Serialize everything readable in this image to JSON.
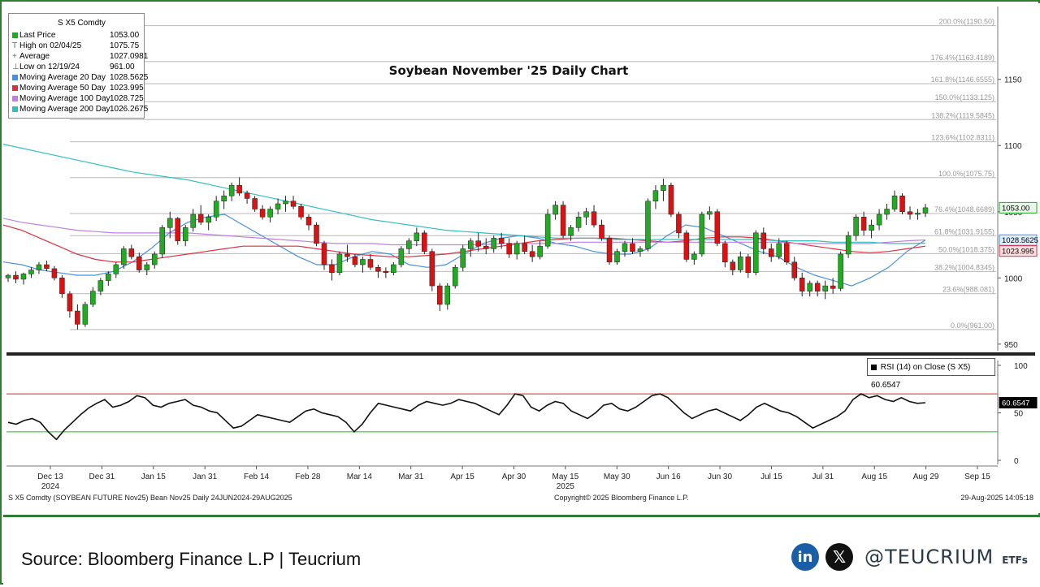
{
  "legend": {
    "title": "S X5 Comdty",
    "rows": [
      {
        "label": "Last Price",
        "value": "1053.00",
        "color": "#22aa22",
        "marker": "⊟"
      },
      {
        "label": "High on 02/04/25",
        "value": "1075.75",
        "color": "",
        "marker": "T"
      },
      {
        "label": "Average",
        "value": "1027.0981",
        "color": "",
        "marker": "+"
      },
      {
        "label": "Low on 12/19/24",
        "value": "961.00",
        "color": "",
        "marker": "⊥"
      },
      {
        "label": "Moving Average 20 Day",
        "value": "1028.5625",
        "color": "#4a90e2",
        "marker": "⊟"
      },
      {
        "label": "Moving Average 50 Day",
        "value": "1023.995",
        "color": "#e03040",
        "marker": "⊟"
      },
      {
        "label": "Moving Average 100 Day",
        "value": "1028.725",
        "color": "#c080e0",
        "marker": "⊟"
      },
      {
        "label": "Moving Average 200 Day",
        "value": "1026.2675",
        "color": "#30c0c0",
        "marker": "⊟"
      }
    ]
  },
  "chart_data": {
    "type": "candlestick",
    "title": "Soybean November '25 Daily Chart",
    "price_axis": {
      "ticks": [
        950,
        1000,
        1050,
        1100,
        1150
      ],
      "range": [
        945,
        1205
      ]
    },
    "rsi_axis": {
      "ticks": [
        0,
        50,
        100
      ],
      "range": [
        0,
        100
      ],
      "overbought": 70,
      "oversold": 30
    },
    "x_labels": [
      "Dec 13",
      "Dec 31",
      "Jan 15",
      "Jan 31",
      "Feb 14",
      "Feb 28",
      "Mar 14",
      "Mar 31",
      "Apr 15",
      "Apr 30",
      "May 15",
      "May 30",
      "Jun 16",
      "Jun 30",
      "Jul 15",
      "Jul 31",
      "Aug 15",
      "Aug 29",
      "Sep 15"
    ],
    "year_labels": [
      {
        "label": "2024",
        "at": "Dec 13"
      },
      {
        "label": "2025",
        "at": "May 15"
      }
    ],
    "fibonacci": [
      {
        "label": "200.0%(1190.50)",
        "value": 1190.5
      },
      {
        "label": "176.4%(1163.4189)",
        "value": 1163.4189
      },
      {
        "label": "161.8%(1146.6555)",
        "value": 1146.6555
      },
      {
        "label": "150.0%(1133.125)",
        "value": 1133.125
      },
      {
        "label": "138.2%(1119.5845)",
        "value": 1119.5845
      },
      {
        "label": "123.6%(1102.8311)",
        "value": 1102.8311
      },
      {
        "label": "100.0%(1075.75)",
        "value": 1075.75
      },
      {
        "label": "76.4%(1048.6689)",
        "value": 1048.6689
      },
      {
        "label": "61.8%(1031.9155)",
        "value": 1031.9155
      },
      {
        "label": "50.0%(1018.375)",
        "value": 1018.375
      },
      {
        "label": "38.2%(1004.8345)",
        "value": 1004.8345
      },
      {
        "label": "23.6%(988.081)",
        "value": 988.081
      },
      {
        "label": "0.0%(961.00)",
        "value": 961.0
      }
    ],
    "candles": [
      [
        1000,
        1003,
        997,
        1002
      ],
      [
        1002,
        1005,
        996,
        999
      ],
      [
        999,
        1004,
        995,
        1003
      ],
      [
        1003,
        1008,
        1000,
        1006
      ],
      [
        1006,
        1012,
        1003,
        1010
      ],
      [
        1010,
        1013,
        1005,
        1007
      ],
      [
        1007,
        1009,
        998,
        1000
      ],
      [
        1000,
        1002,
        985,
        988
      ],
      [
        988,
        990,
        970,
        975
      ],
      [
        975,
        980,
        961,
        965
      ],
      [
        965,
        982,
        963,
        980
      ],
      [
        980,
        993,
        978,
        990
      ],
      [
        990,
        1000,
        987,
        998
      ],
      [
        998,
        1005,
        994,
        1003
      ],
      [
        1003,
        1012,
        1000,
        1010
      ],
      [
        1010,
        1024,
        1007,
        1022
      ],
      [
        1022,
        1025,
        1014,
        1016
      ],
      [
        1016,
        1019,
        1004,
        1006
      ],
      [
        1006,
        1012,
        1002,
        1010
      ],
      [
        1010,
        1020,
        1007,
        1018
      ],
      [
        1018,
        1040,
        1015,
        1038
      ],
      [
        1038,
        1050,
        1030,
        1045
      ],
      [
        1045,
        1046,
        1025,
        1028
      ],
      [
        1028,
        1040,
        1024,
        1038
      ],
      [
        1038,
        1052,
        1035,
        1048
      ],
      [
        1048,
        1055,
        1040,
        1042
      ],
      [
        1042,
        1048,
        1036,
        1046
      ],
      [
        1046,
        1062,
        1043,
        1058
      ],
      [
        1058,
        1066,
        1052,
        1062
      ],
      [
        1062,
        1072,
        1058,
        1070
      ],
      [
        1070,
        1076,
        1062,
        1064
      ],
      [
        1064,
        1066,
        1056,
        1060
      ],
      [
        1060,
        1062,
        1050,
        1052
      ],
      [
        1052,
        1055,
        1044,
        1046
      ],
      [
        1046,
        1054,
        1042,
        1052
      ],
      [
        1052,
        1060,
        1048,
        1056
      ],
      [
        1056,
        1062,
        1050,
        1058
      ],
      [
        1058,
        1062,
        1052,
        1054
      ],
      [
        1054,
        1056,
        1044,
        1046
      ],
      [
        1046,
        1048,
        1036,
        1040
      ],
      [
        1040,
        1042,
        1024,
        1026
      ],
      [
        1026,
        1028,
        1006,
        1010
      ],
      [
        1010,
        1014,
        998,
        1004
      ],
      [
        1004,
        1020,
        1002,
        1018
      ],
      [
        1018,
        1025,
        1012,
        1016
      ],
      [
        1016,
        1018,
        1008,
        1010
      ],
      [
        1010,
        1016,
        1004,
        1014
      ],
      [
        1014,
        1018,
        1006,
        1008
      ],
      [
        1008,
        1010,
        1000,
        1005
      ],
      [
        1005,
        1008,
        1000,
        1004
      ],
      [
        1004,
        1012,
        1002,
        1010
      ],
      [
        1010,
        1024,
        1008,
        1022
      ],
      [
        1022,
        1030,
        1018,
        1028
      ],
      [
        1028,
        1038,
        1024,
        1034
      ],
      [
        1034,
        1036,
        1018,
        1020
      ],
      [
        1020,
        1022,
        990,
        994
      ],
      [
        994,
        996,
        975,
        980
      ],
      [
        980,
        996,
        976,
        994
      ],
      [
        994,
        1010,
        992,
        1008
      ],
      [
        1008,
        1025,
        1005,
        1022
      ],
      [
        1022,
        1030,
        1016,
        1028
      ],
      [
        1028,
        1034,
        1020,
        1024
      ],
      [
        1024,
        1030,
        1018,
        1022
      ],
      [
        1022,
        1032,
        1019,
        1030
      ],
      [
        1030,
        1034,
        1022,
        1026
      ],
      [
        1026,
        1030,
        1015,
        1018
      ],
      [
        1018,
        1028,
        1014,
        1026
      ],
      [
        1026,
        1032,
        1018,
        1020
      ],
      [
        1020,
        1025,
        1012,
        1016
      ],
      [
        1016,
        1028,
        1014,
        1024
      ],
      [
        1024,
        1052,
        1022,
        1048
      ],
      [
        1048,
        1058,
        1044,
        1055
      ],
      [
        1055,
        1058,
        1030,
        1032
      ],
      [
        1032,
        1040,
        1028,
        1038
      ],
      [
        1038,
        1050,
        1035,
        1046
      ],
      [
        1046,
        1053,
        1040,
        1050
      ],
      [
        1050,
        1055,
        1038,
        1040
      ],
      [
        1040,
        1044,
        1028,
        1030
      ],
      [
        1030,
        1032,
        1010,
        1012
      ],
      [
        1012,
        1022,
        1010,
        1020
      ],
      [
        1020,
        1028,
        1016,
        1026
      ],
      [
        1026,
        1030,
        1018,
        1020
      ],
      [
        1020,
        1024,
        1016,
        1022
      ],
      [
        1022,
        1060,
        1020,
        1058
      ],
      [
        1058,
        1070,
        1052,
        1066
      ],
      [
        1066,
        1075,
        1058,
        1070
      ],
      [
        1070,
        1072,
        1046,
        1048
      ],
      [
        1048,
        1050,
        1030,
        1034
      ],
      [
        1034,
        1036,
        1012,
        1014
      ],
      [
        1014,
        1020,
        1010,
        1018
      ],
      [
        1018,
        1050,
        1016,
        1048
      ],
      [
        1048,
        1054,
        1044,
        1050
      ],
      [
        1050,
        1052,
        1024,
        1026
      ],
      [
        1026,
        1028,
        1008,
        1012
      ],
      [
        1012,
        1014,
        1002,
        1006
      ],
      [
        1006,
        1020,
        1004,
        1016
      ],
      [
        1016,
        1018,
        1000,
        1004
      ],
      [
        1004,
        1036,
        1002,
        1034
      ],
      [
        1034,
        1038,
        1018,
        1022
      ],
      [
        1022,
        1026,
        1012,
        1016
      ],
      [
        1016,
        1030,
        1014,
        1026
      ],
      [
        1026,
        1028,
        1010,
        1012
      ],
      [
        1012,
        1016,
        998,
        1000
      ],
      [
        1000,
        1004,
        986,
        990
      ],
      [
        990,
        998,
        986,
        996
      ],
      [
        996,
        998,
        986,
        990
      ],
      [
        990,
        998,
        984,
        994
      ],
      [
        994,
        1000,
        988,
        992
      ],
      [
        992,
        1020,
        990,
        1018
      ],
      [
        1018,
        1035,
        1015,
        1032
      ],
      [
        1032,
        1048,
        1028,
        1046
      ],
      [
        1046,
        1050,
        1032,
        1036
      ],
      [
        1036,
        1044,
        1030,
        1040
      ],
      [
        1040,
        1052,
        1036,
        1048
      ],
      [
        1048,
        1056,
        1044,
        1052
      ],
      [
        1052,
        1066,
        1050,
        1062
      ],
      [
        1062,
        1064,
        1048,
        1050
      ],
      [
        1050,
        1054,
        1044,
        1048
      ],
      [
        1048,
        1052,
        1044,
        1049
      ],
      [
        1049,
        1056,
        1046,
        1053
      ]
    ],
    "moving_averages": [
      {
        "name": "Moving Average 20 Day",
        "color": "#4a90e2",
        "values": [
          1012,
          1010,
          1006,
          1004,
          1002,
          1002,
          1005,
          1012,
          1022,
          1034,
          1042,
          1046,
          1048,
          1040,
          1032,
          1024,
          1016,
          1010,
          1010,
          1016,
          1020,
          1018,
          1010,
          1008,
          1010,
          1018,
          1026,
          1030,
          1032,
          1030,
          1026,
          1024,
          1020,
          1018,
          1018,
          1022,
          1032,
          1040,
          1038,
          1032,
          1026,
          1020,
          1016,
          1008,
          1002,
          998,
          994,
          1000,
          1008,
          1020,
          1028.5625
        ]
      },
      {
        "name": "Moving Average 50 Day",
        "color": "#e03040",
        "values": [
          1040,
          1036,
          1030,
          1024,
          1018,
          1014,
          1012,
          1012,
          1014,
          1016,
          1018,
          1020,
          1022,
          1024,
          1024,
          1024,
          1024,
          1022,
          1020,
          1018,
          1017,
          1016,
          1016,
          1017,
          1018,
          1020,
          1022,
          1024,
          1026,
          1028,
          1029,
          1030,
          1030,
          1030,
          1029,
          1028,
          1027,
          1028,
          1030,
          1031,
          1031,
          1030,
          1028,
          1026,
          1024,
          1022,
          1020,
          1019,
          1020,
          1022,
          1023.995
        ]
      },
      {
        "name": "Moving Average 100 Day",
        "color": "#c080e0",
        "values": [
          1045,
          1042,
          1040,
          1038,
          1036,
          1035,
          1034,
          1034,
          1034,
          1034,
          1034,
          1033,
          1032,
          1031,
          1030,
          1029,
          1028,
          1027,
          1026,
          1026,
          1026,
          1025,
          1025,
          1025,
          1025,
          1025,
          1025,
          1026,
          1026,
          1026,
          1026,
          1027,
          1027,
          1027,
          1027,
          1027,
          1027,
          1027,
          1027,
          1027,
          1027,
          1027,
          1027,
          1026,
          1026,
          1026,
          1026,
          1026,
          1027,
          1028,
          1028.725
        ]
      },
      {
        "name": "Moving Average 200 Day",
        "color": "#30c0c0",
        "values": [
          1101,
          1098,
          1095,
          1092,
          1089,
          1086,
          1083,
          1080,
          1078,
          1076,
          1074,
          1071,
          1068,
          1065,
          1062,
          1059,
          1056,
          1053,
          1050,
          1047,
          1044,
          1042,
          1040,
          1038,
          1036,
          1035,
          1034,
          1033,
          1032,
          1031,
          1030,
          1030,
          1030,
          1029,
          1029,
          1029,
          1029,
          1029,
          1029,
          1029,
          1029,
          1029,
          1028,
          1028,
          1028,
          1027,
          1027,
          1027,
          1026,
          1026,
          1026.2675
        ]
      }
    ],
    "rsi": {
      "name": "RSI (14)  on Close (S X5)",
      "last": 60.6547,
      "values": [
        40,
        38,
        42,
        44,
        40,
        30,
        22,
        32,
        40,
        48,
        55,
        60,
        64,
        56,
        58,
        62,
        68,
        66,
        58,
        56,
        60,
        62,
        64,
        58,
        56,
        52,
        50,
        42,
        34,
        36,
        42,
        48,
        46,
        44,
        42,
        40,
        46,
        52,
        54,
        50,
        48,
        46,
        40,
        30,
        38,
        50,
        60,
        58,
        56,
        54,
        52,
        58,
        62,
        60,
        58,
        60,
        64,
        62,
        60,
        56,
        52,
        48,
        58,
        70,
        68,
        56,
        52,
        58,
        62,
        60,
        52,
        48,
        44,
        50,
        58,
        60,
        54,
        52,
        56,
        62,
        68,
        70,
        66,
        58,
        50,
        44,
        48,
        52,
        54,
        50,
        46,
        42,
        48,
        56,
        60,
        56,
        52,
        50,
        46,
        40,
        34,
        38,
        42,
        46,
        52,
        64,
        70,
        66,
        68,
        64,
        62,
        66,
        62,
        60,
        60.6547
      ]
    },
    "price_tags": [
      {
        "label": "1053.00",
        "value": 1053.0,
        "color": "#22aa22"
      },
      {
        "label": "1028.5625",
        "value": 1028.5625,
        "color": "#4a90e2"
      },
      {
        "label": "1023.995",
        "value": 1023.995,
        "color": "#e03040"
      },
      {
        "label": "60.6547",
        "value": 60.6547,
        "color": "#000000"
      }
    ]
  },
  "footer": {
    "security_line": "S X5 Comdty (SOYBEAN FUTURE   Nov25) Bean Nov25  Daily 24JUN2024-29AUG2025",
    "copyright": "Copyright© 2025 Bloomberg Finance L.P.",
    "timestamp": "29-Aug-2025 14:05:18",
    "source": "Source: Bloomberg Finance L.P | Teucrium",
    "brand": "@TEUCRIUM",
    "brand_sub": "ETFs",
    "linkedin_glyph": "in",
    "x_glyph": "𝕏"
  }
}
